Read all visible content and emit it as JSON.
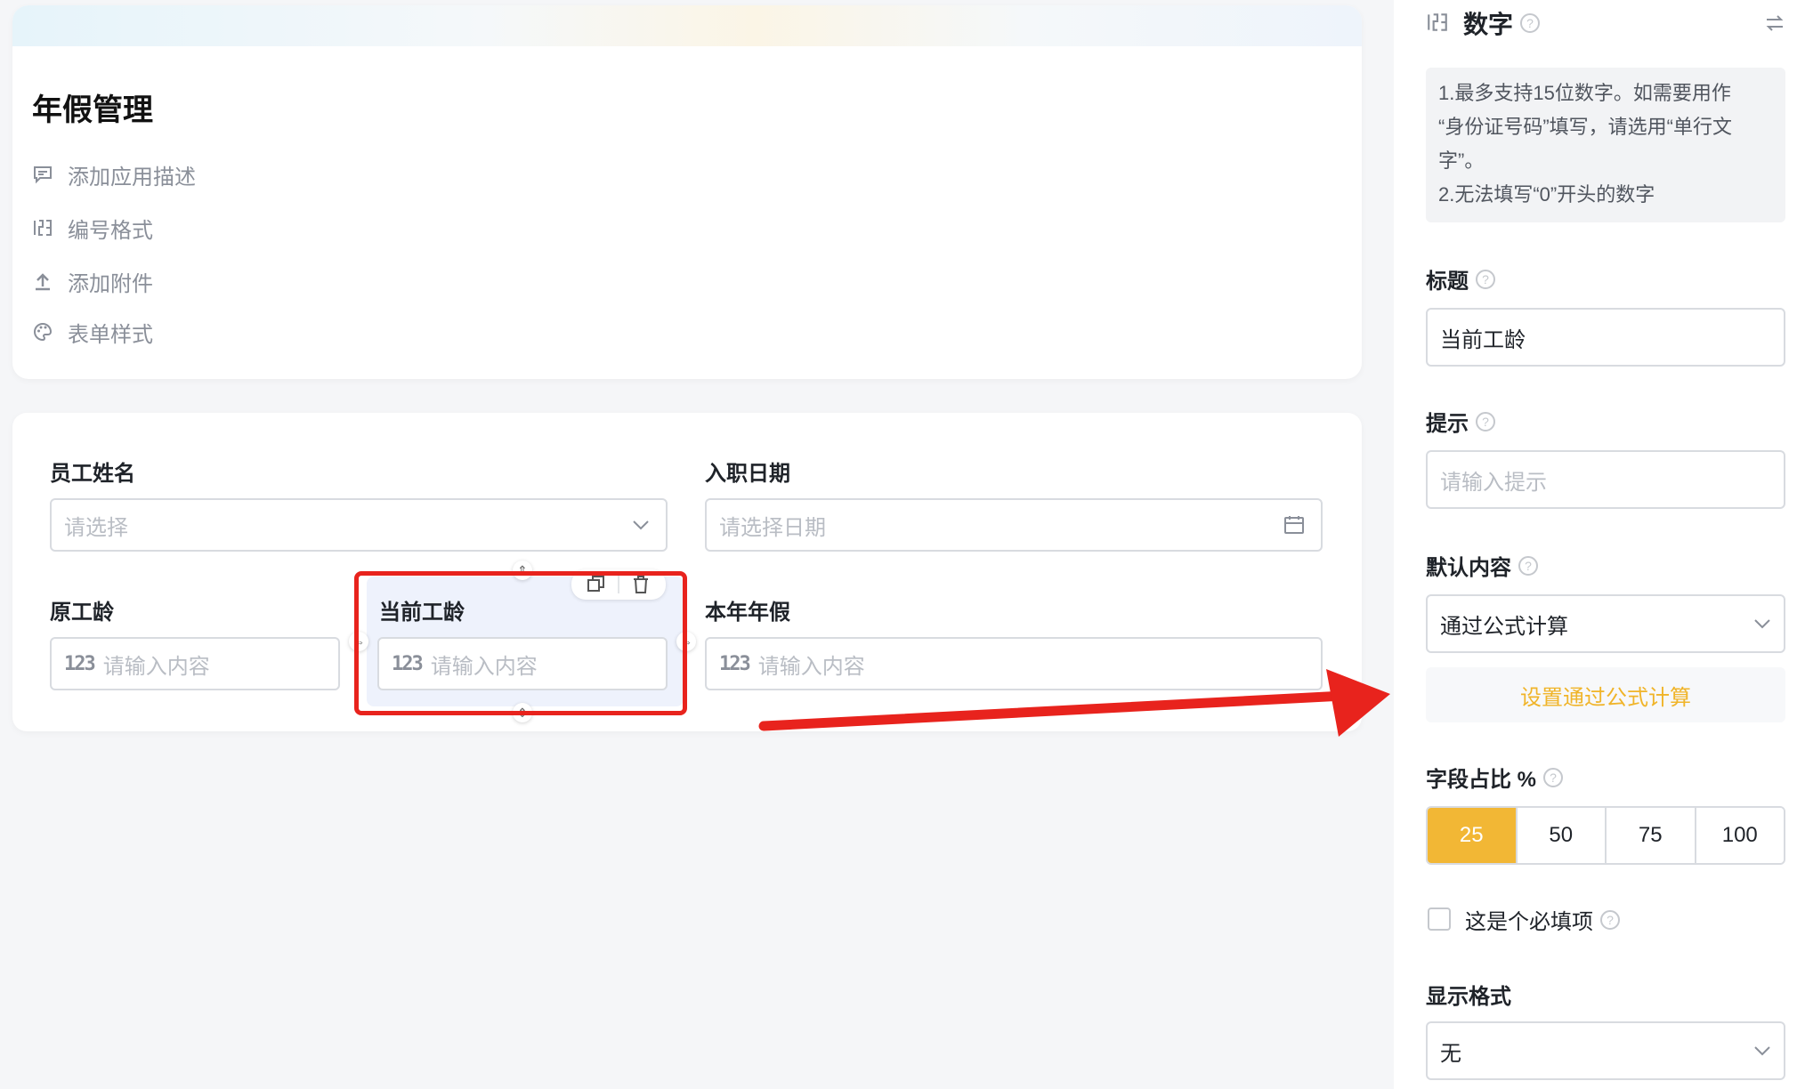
{
  "app": {
    "title": "年假管理",
    "menu": [
      {
        "label": "添加应用描述",
        "icon": "comment-icon"
      },
      {
        "label": "编号格式",
        "icon": "number-format-icon"
      },
      {
        "label": "添加附件",
        "icon": "upload-icon"
      },
      {
        "label": "表单样式",
        "icon": "palette-icon"
      }
    ]
  },
  "form": {
    "fields": [
      {
        "label": "员工姓名",
        "placeholder": "请选择",
        "type": "select"
      },
      {
        "label": "入职日期",
        "placeholder": "请选择日期",
        "type": "date"
      },
      {
        "label": "原工龄",
        "placeholder": "请输入内容",
        "type": "number"
      },
      {
        "label": "当前工龄",
        "placeholder": "请输入内容",
        "type": "number",
        "selected": true
      },
      {
        "label": "本年年假",
        "placeholder": "请输入内容",
        "type": "number"
      }
    ],
    "number_icon_text": "123"
  },
  "panel": {
    "header": {
      "title": "数字"
    },
    "tip": {
      "line1": "1.最多支持15位数字。如需要用作",
      "line2": "“身份证号码”填写，请选用“单行文",
      "line3": "字”。",
      "line4": "2.无法填写“0”开头的数字"
    },
    "title_label": "标题",
    "title_value": "当前工龄",
    "hint_label": "提示",
    "hint_placeholder": "请输入提示",
    "default_label": "默认内容",
    "default_value": "通过公式计算",
    "formula_button": "设置通过公式计算",
    "ratio_label": "字段占比 %",
    "ratio_options": [
      "25",
      "50",
      "75",
      "100"
    ],
    "ratio_selected": "25",
    "required_label": "这是个必填项",
    "required_checked": false,
    "display_format_label": "显示格式",
    "display_format_value": "无"
  },
  "colors": {
    "accent": "#f2b735",
    "annotation": "#e8231d",
    "selected_bg": "#eef2fc"
  }
}
